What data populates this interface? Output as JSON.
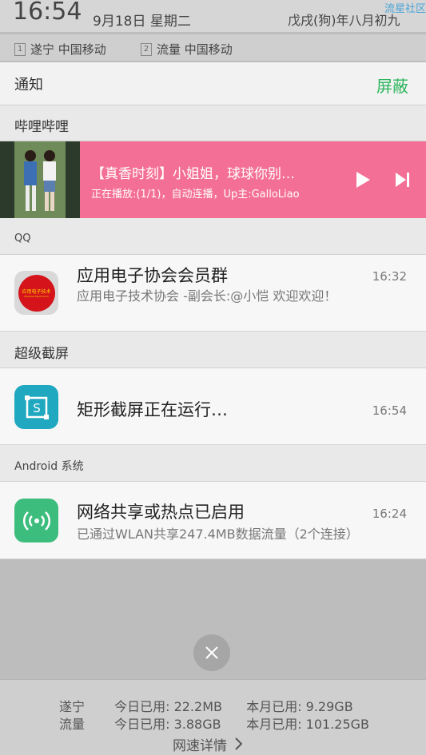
{
  "status": {
    "time": "16:54",
    "date": "9月18日  星期二",
    "lunar": "戊戌(狗)年八月初九",
    "watermark": "流星社区"
  },
  "carriers": [
    {
      "slot": "1",
      "label": "遂宁 中国移动"
    },
    {
      "slot": "2",
      "label": "流量 中国移动"
    }
  ],
  "notif_header": {
    "title": "通知",
    "block_label": "屏蔽"
  },
  "bilibili": {
    "group": "哔哩哔哩",
    "title": "【真香时刻】小姐姐，球球你别…",
    "subtitle": "正在播放:(1/1)，自动连播，Up主:GalloLiao"
  },
  "qq": {
    "group": "QQ",
    "title": "应用电子协会会员群",
    "time": "16:32",
    "text": "应用电子技术协会 -副会长:@小恺  欢迎欢迎！",
    "icon_text": "应用电子技术",
    "icon_subtext": "Practical Electrical A"
  },
  "screenshot": {
    "group": "超级截屏",
    "title": "矩形截屏正在运行…",
    "time": "16:54"
  },
  "android": {
    "group": "Android 系统",
    "title": "网络共享或热点已启用",
    "time": "16:24",
    "text": "已通过WLAN共享247.4MB数据流量（2个连接）"
  },
  "footer": {
    "row1_name": "遂宁",
    "row1_today": "今日已用: 22.2MB",
    "row1_month": "本月已用: 9.29GB",
    "row2_name": "流量",
    "row2_today": "今日已用: 3.88GB",
    "row2_month": "本月已用: 101.25GB",
    "link": "网速详情"
  },
  "colors": {
    "media_bg": "#f46f95",
    "block_green": "#2db55d",
    "screenshot_icon": "#1fa8c0",
    "android_icon": "#3dbd7d"
  }
}
